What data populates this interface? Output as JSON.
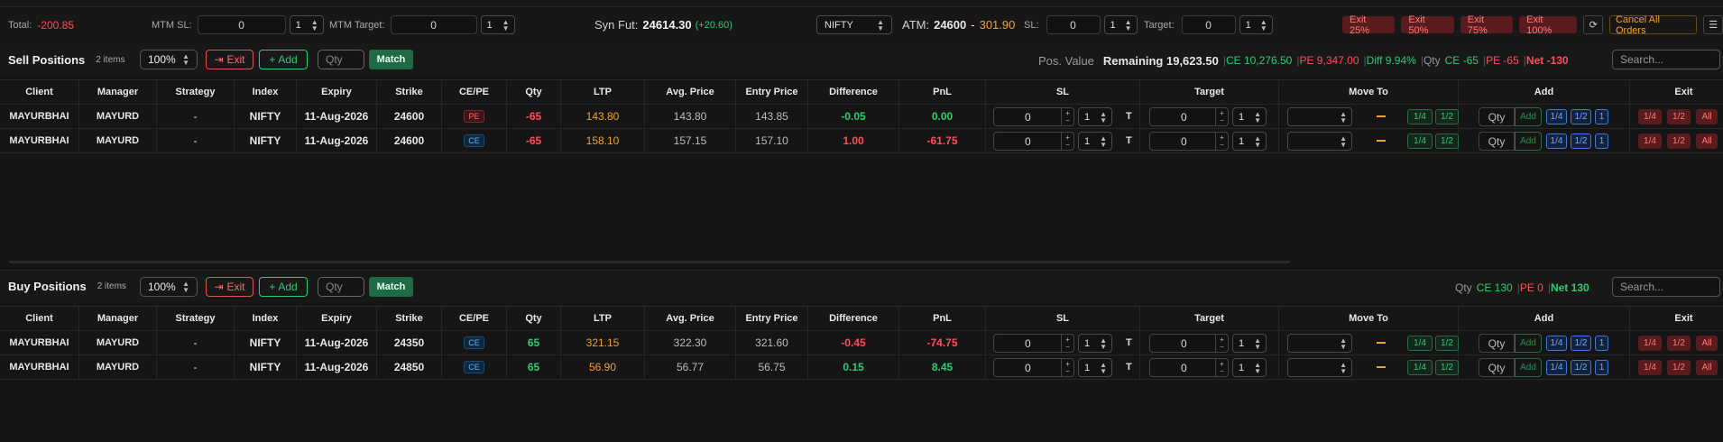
{
  "topbar": {
    "total_label": "Total:",
    "total_value": "-200.85",
    "mtm_sl_label": "MTM SL:",
    "mtm_sl_value": "0",
    "mtm_sl_step": "1",
    "mtm_target_label": "MTM Target:",
    "mtm_target_value": "0",
    "mtm_target_step": "1",
    "syn_fut_label": "Syn Fut:",
    "syn_fut_value": "24614.30",
    "syn_fut_change": "(+20.60)",
    "symbol": "NIFTY",
    "atm_label": "ATM:",
    "atm_strike": "24600",
    "atm_dash": "-",
    "atm_price": "301.90",
    "sl_label": "SL:",
    "sl_value": "0",
    "sl_step": "1",
    "target_label": "Target:",
    "target_value": "0",
    "target_step": "1",
    "exit_buttons": [
      "Exit 25%",
      "Exit 50%",
      "Exit 75%",
      "Exit 100%"
    ],
    "cancel_all": "Cancel All Orders",
    "refresh_icon": "refresh-icon",
    "settings_icon": "sliders-icon"
  },
  "columns": [
    "Client",
    "Manager",
    "Strategy",
    "Index",
    "Expiry",
    "Strike",
    "CE/PE",
    "Qty",
    "LTP",
    "Avg. Price",
    "Entry Price",
    "Difference",
    "PnL",
    "SL",
    "Target",
    "Move To",
    "Add",
    "Exit"
  ],
  "sell": {
    "title": "Sell Positions",
    "count": "2 items",
    "zoom": "100%",
    "exit_label": "Exit",
    "add_label": "Add",
    "qty_placeholder": "Qty",
    "match_label": "Match",
    "pos_value_label": "Pos. Value",
    "remaining": "Remaining 19,623.50",
    "ce_value": "CE 10,276.50",
    "pe_value": "PE 9,347.00",
    "diff_value": "Diff 9.94%",
    "qty_label": "Qty",
    "qty_ce": "CE -65",
    "qty_pe": "PE -65",
    "net": "Net -130",
    "search_placeholder": "Search...",
    "rows": [
      {
        "client": "MAYURBHAI",
        "manager": "MAYURD",
        "strategy": "-",
        "index": "NIFTY",
        "expiry": "11-Aug-2026",
        "strike": "24600",
        "type": "PE",
        "qty": "-65",
        "ltp": "143.80",
        "avg": "143.80",
        "entry": "143.85",
        "diff": "-0.05",
        "pnl": "0.00",
        "sl": "0",
        "sl_step": "1",
        "target": "0",
        "target_step": "1",
        "t": "T"
      },
      {
        "client": "MAYURBHAI",
        "manager": "MAYURD",
        "strategy": "-",
        "index": "NIFTY",
        "expiry": "11-Aug-2026",
        "strike": "24600",
        "type": "CE",
        "qty": "-65",
        "ltp": "158.10",
        "avg": "157.15",
        "entry": "157.10",
        "diff": "1.00",
        "pnl": "-61.75",
        "sl": "0",
        "sl_step": "1",
        "target": "0",
        "target_step": "1",
        "t": "T"
      }
    ]
  },
  "buy": {
    "title": "Buy Positions",
    "count": "2 items",
    "zoom": "100%",
    "exit_label": "Exit",
    "add_label": "Add",
    "qty_placeholder": "Qty",
    "match_label": "Match",
    "qty_label": "Qty",
    "qty_ce": "CE 130",
    "qty_pe": "PE 0",
    "net": "Net 130",
    "search_placeholder": "Search...",
    "rows": [
      {
        "client": "MAYURBHAI",
        "manager": "MAYURD",
        "strategy": "-",
        "index": "NIFTY",
        "expiry": "11-Aug-2026",
        "strike": "24350",
        "type": "CE",
        "qty": "65",
        "ltp": "321.15",
        "avg": "322.30",
        "entry": "321.60",
        "diff": "-0.45",
        "pnl": "-74.75",
        "sl": "0",
        "sl_step": "1",
        "target": "0",
        "target_step": "1",
        "t": "T"
      },
      {
        "client": "MAYURBHAI",
        "manager": "MAYURD",
        "strategy": "-",
        "index": "NIFTY",
        "expiry": "11-Aug-2026",
        "strike": "24850",
        "type": "CE",
        "qty": "65",
        "ltp": "56.90",
        "avg": "56.77",
        "entry": "56.75",
        "diff": "0.15",
        "pnl": "8.45",
        "sl": "0",
        "sl_step": "1",
        "target": "0",
        "target_step": "1",
        "t": "T"
      }
    ]
  },
  "row_actions": {
    "move_quarter": "1/4",
    "move_half": "1/2",
    "add_qty_placeholder": "Qty",
    "add_label": "Add",
    "add_quarter": "1/4",
    "add_half": "1/2",
    "add_one": "1",
    "exit_quarter": "1/4",
    "exit_half": "1/2",
    "exit_all": "All"
  },
  "colors": {
    "green": "#2ecc71",
    "red": "#ff4d5a",
    "orange": "#f0a22e",
    "blue": "#5fb0ff"
  }
}
